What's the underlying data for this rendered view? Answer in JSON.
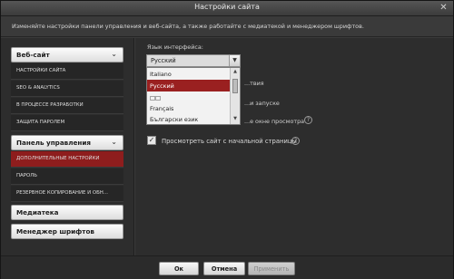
{
  "window": {
    "title": "Настройки сайта"
  },
  "description": "Изменяйте настройки панели управления и веб-сайта, а также работайте с медиатекой и менеджером шрифтов.",
  "sidebar": {
    "groups": [
      {
        "label": "Веб-сайт",
        "items": [
          "НАСТРОЙКИ САЙТА",
          "SEO & ANALYTICS",
          "В ПРОЦЕССЕ РАЗРАБОТКИ",
          "ЗАЩИТА ПАРОЛЕМ"
        ]
      },
      {
        "label": "Панель управления",
        "items": [
          "ДОПОЛНИТЕЛЬНЫЕ НАСТРОЙКИ",
          "ПАРОЛЬ",
          "РЕЗЕРВНОЕ КОПИРОВАНИЕ И ОБН..."
        ]
      },
      {
        "label": "Медиатека",
        "items": []
      },
      {
        "label": "Менеджер шрифтов",
        "items": []
      }
    ],
    "active_item": "ДОПОЛНИТЕЛЬНЫЕ НАСТРОЙКИ"
  },
  "content": {
    "language_label": "Язык интерфейса:",
    "language_value": "Русский",
    "language_options": [
      "Italiano",
      "Русский",
      "□□",
      "Français",
      "Български език"
    ],
    "partial_labels": [
      "...твия",
      "...и запуске",
      "...е окне просмотра"
    ],
    "checkbox": {
      "label": "Просмотреть сайт с начальной страницы",
      "checked": true
    }
  },
  "footer": {
    "ok": "Ок",
    "cancel": "Отмена",
    "apply": "Применить"
  },
  "icons": {
    "close": "close-icon",
    "chevron": "chevron-down-icon",
    "help": "help-icon",
    "check": "checkmark-icon"
  },
  "colors": {
    "accent": "#8e1d1d",
    "selected_option": "#9a2020",
    "background": "#2d2d2d"
  }
}
